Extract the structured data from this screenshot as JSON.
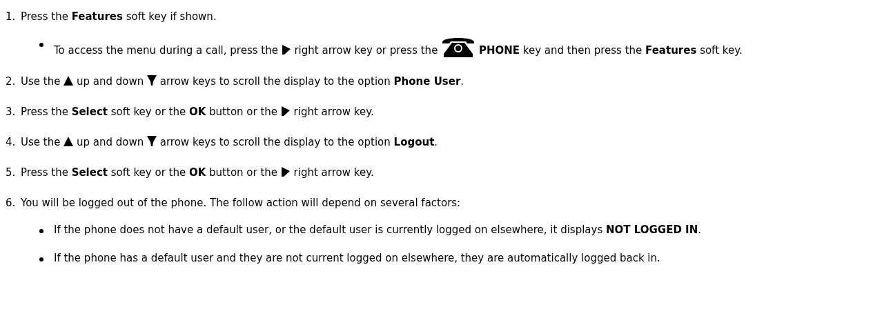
{
  "steps": [
    {
      "number": "1.",
      "parts": [
        {
          "kind": "text",
          "text": "Press the **Features** soft key if shown."
        }
      ],
      "bullets": [
        {
          "parts": [
            {
              "kind": "text",
              "text": "To access the menu during a call, press the "
            },
            {
              "kind": "key_right"
            },
            {
              "kind": "text",
              "text": " right arrow key or press the "
            },
            {
              "kind": "key_phone"
            },
            {
              "kind": "text",
              "text": " **PHONE** key and then press the **Features** soft key."
            }
          ]
        }
      ]
    },
    {
      "number": "2.",
      "parts": [
        {
          "kind": "text",
          "text": "Use the "
        },
        {
          "kind": "key_up"
        },
        {
          "kind": "text",
          "text": " up and down "
        },
        {
          "kind": "key_down"
        },
        {
          "kind": "text",
          "text": " arrow keys to scroll the display to the option **Phone User**."
        }
      ]
    },
    {
      "number": "3.",
      "parts": [
        {
          "kind": "text",
          "text": "Press the **Select** soft key or the **OK** button or the "
        },
        {
          "kind": "key_right"
        },
        {
          "kind": "text",
          "text": " right arrow key."
        }
      ]
    },
    {
      "number": "4.",
      "parts": [
        {
          "kind": "text",
          "text": "Use the "
        },
        {
          "kind": "key_up"
        },
        {
          "kind": "text",
          "text": " up and down "
        },
        {
          "kind": "key_down"
        },
        {
          "kind": "text",
          "text": " arrow keys to scroll the display to the option **Logout**."
        }
      ]
    },
    {
      "number": "5.",
      "parts": [
        {
          "kind": "text",
          "text": "Press the **Select** soft key or the **OK** button or the "
        },
        {
          "kind": "key_right"
        },
        {
          "kind": "text",
          "text": " right arrow key."
        }
      ]
    },
    {
      "number": "6.",
      "parts": [
        {
          "kind": "text",
          "text": "You will be logged out of the phone. The follow action will depend on several factors:"
        }
      ],
      "bullets": [
        {
          "parts": [
            {
              "kind": "text",
              "text": "If the phone does not have a default user, or the default user is currently logged on elsewhere, it displays **NOT LOGGED IN**."
            }
          ]
        },
        {
          "parts": [
            {
              "kind": "text",
              "text": "If the phone has a default user and they are not current logged on elsewhere, they are automatically logged back in."
            }
          ]
        }
      ]
    }
  ]
}
